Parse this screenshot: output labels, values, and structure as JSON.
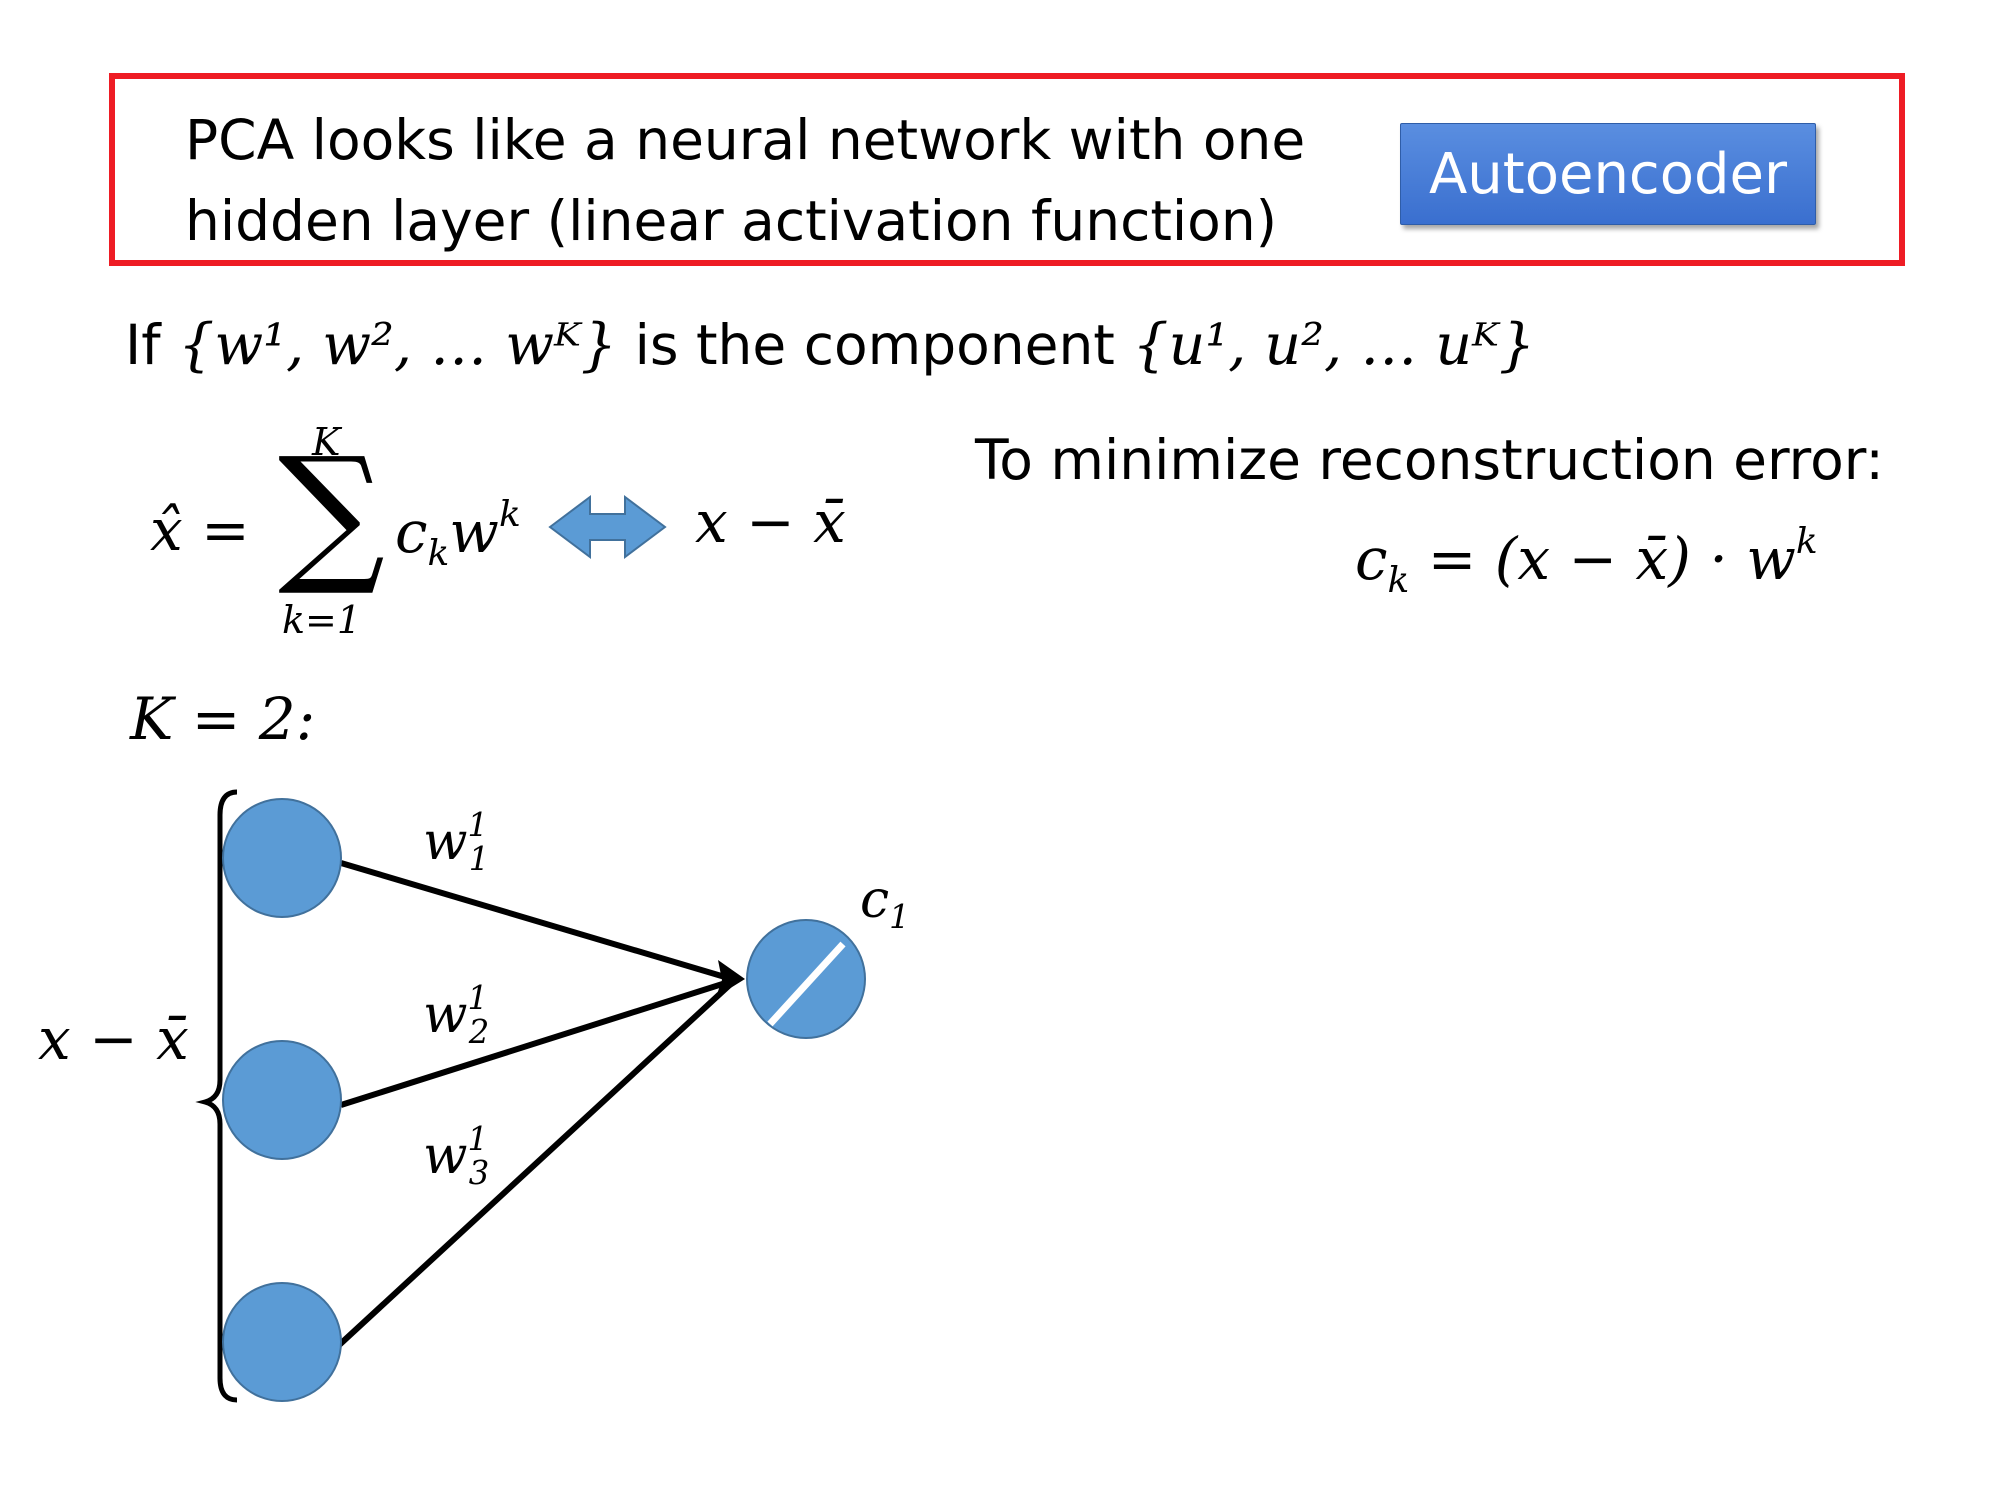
{
  "callout": {
    "text_line1": "PCA looks like a neural network with one",
    "text_line2": "hidden layer (linear activation function)",
    "button_label": "Autoencoder"
  },
  "if_line": {
    "prefix": "If",
    "w_set": "{w¹, w², … wᴷ}",
    "middle": "is the component",
    "u_set": "{u¹, u², … uᴷ}"
  },
  "reconstruction": {
    "xhat": "x̂ =",
    "sum_upper": "K",
    "sum_lower": "k=1",
    "sum_symbol": "∑",
    "term": "c",
    "term_sub": "k",
    "term_w": "w",
    "term_sup": "k",
    "equiv_rhs": "x − x̄"
  },
  "minimize": {
    "label": "To minimize reconstruction error:",
    "formula_lhs": "c",
    "formula_lhs_sub": "k",
    "formula_rhs": "= (x − x̄) · w",
    "formula_rhs_sup": "k"
  },
  "k_value": "K = 2:",
  "network": {
    "input_label": "x − x̄",
    "output_label": "c",
    "output_label_sub": "1",
    "weights": [
      {
        "base": "w",
        "sub": "1",
        "sup": "1"
      },
      {
        "base": "w",
        "sub": "2",
        "sup": "1"
      },
      {
        "base": "w",
        "sub": "3",
        "sup": "1"
      }
    ]
  },
  "colors": {
    "callout_border": "#ee1c24",
    "button_fill": "#4472c4",
    "node_fill": "#5b9bd5",
    "node_stroke": "#41719c",
    "arrow_fill": "#5b9bd5"
  }
}
